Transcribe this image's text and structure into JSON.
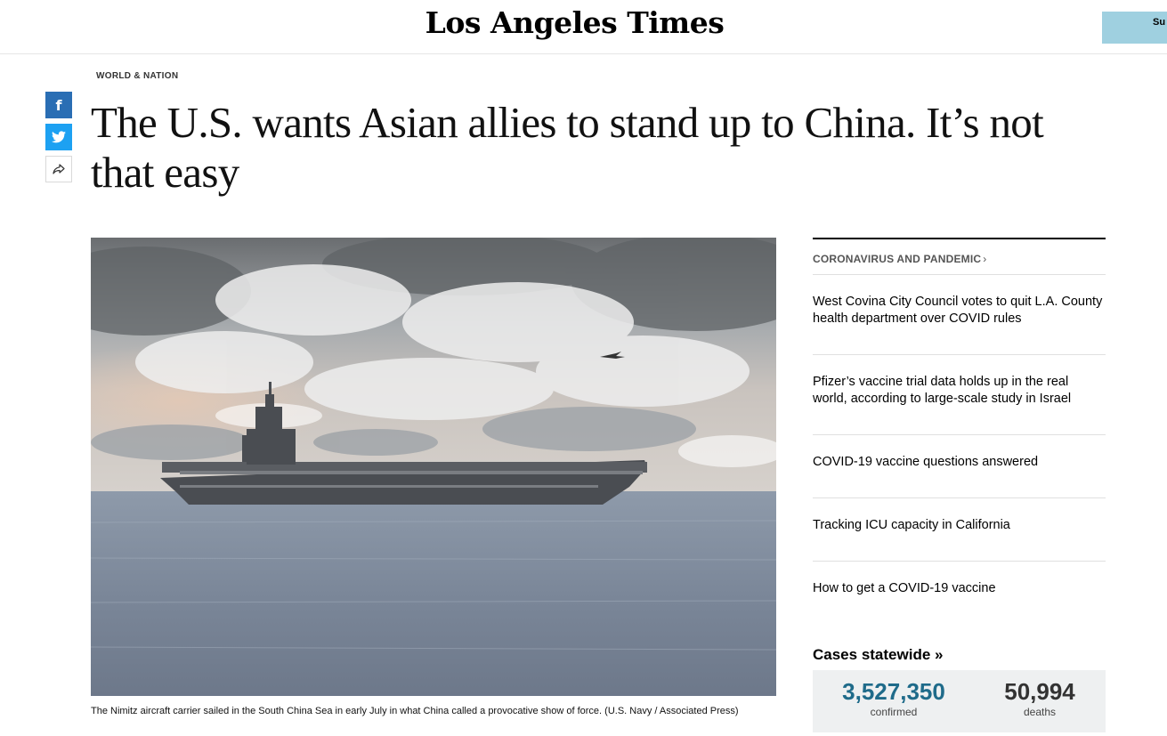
{
  "header": {
    "logo": "Los Angeles Times",
    "subscribe_label": "Su $"
  },
  "article": {
    "section": "WORLD & NATION",
    "headline": "The U.S. wants Asian allies to stand up to China. It’s not that easy",
    "share": {
      "facebook_icon": "facebook-icon",
      "twitter_icon": "twitter-icon",
      "share_icon": "share-arrow-icon"
    },
    "photo_alt": "aircraft-carrier-photo",
    "caption": "The Nimitz aircraft carrier sailed in the South China Sea in early July in what China called a provocative show of force. (U.S. Navy / Associated Press)"
  },
  "sidebar": {
    "heading": "CORONAVIRUS AND PANDEMIC",
    "heading_chevron": "›",
    "items": [
      {
        "label": "West Covina City Council votes to quit L.A. County health department over COVID rules"
      },
      {
        "label": "Pfizer’s vaccine trial data holds up in the real world, according to large-scale study in Israel"
      },
      {
        "label": "COVID-19 vaccine questions answered"
      },
      {
        "label": "Tracking ICU capacity in California"
      },
      {
        "label": "How to get a COVID-19 vaccine"
      }
    ],
    "cases": {
      "title": "Cases statewide »",
      "confirmed_value": "3,527,350",
      "confirmed_label": "confirmed",
      "deaths_value": "50,994",
      "deaths_label": "deaths"
    }
  },
  "colors": {
    "facebook": "#2a6eb4",
    "twitter": "#1da1f2",
    "subscribe": "#9fd0e0",
    "confirmed": "#1f6b8a"
  }
}
